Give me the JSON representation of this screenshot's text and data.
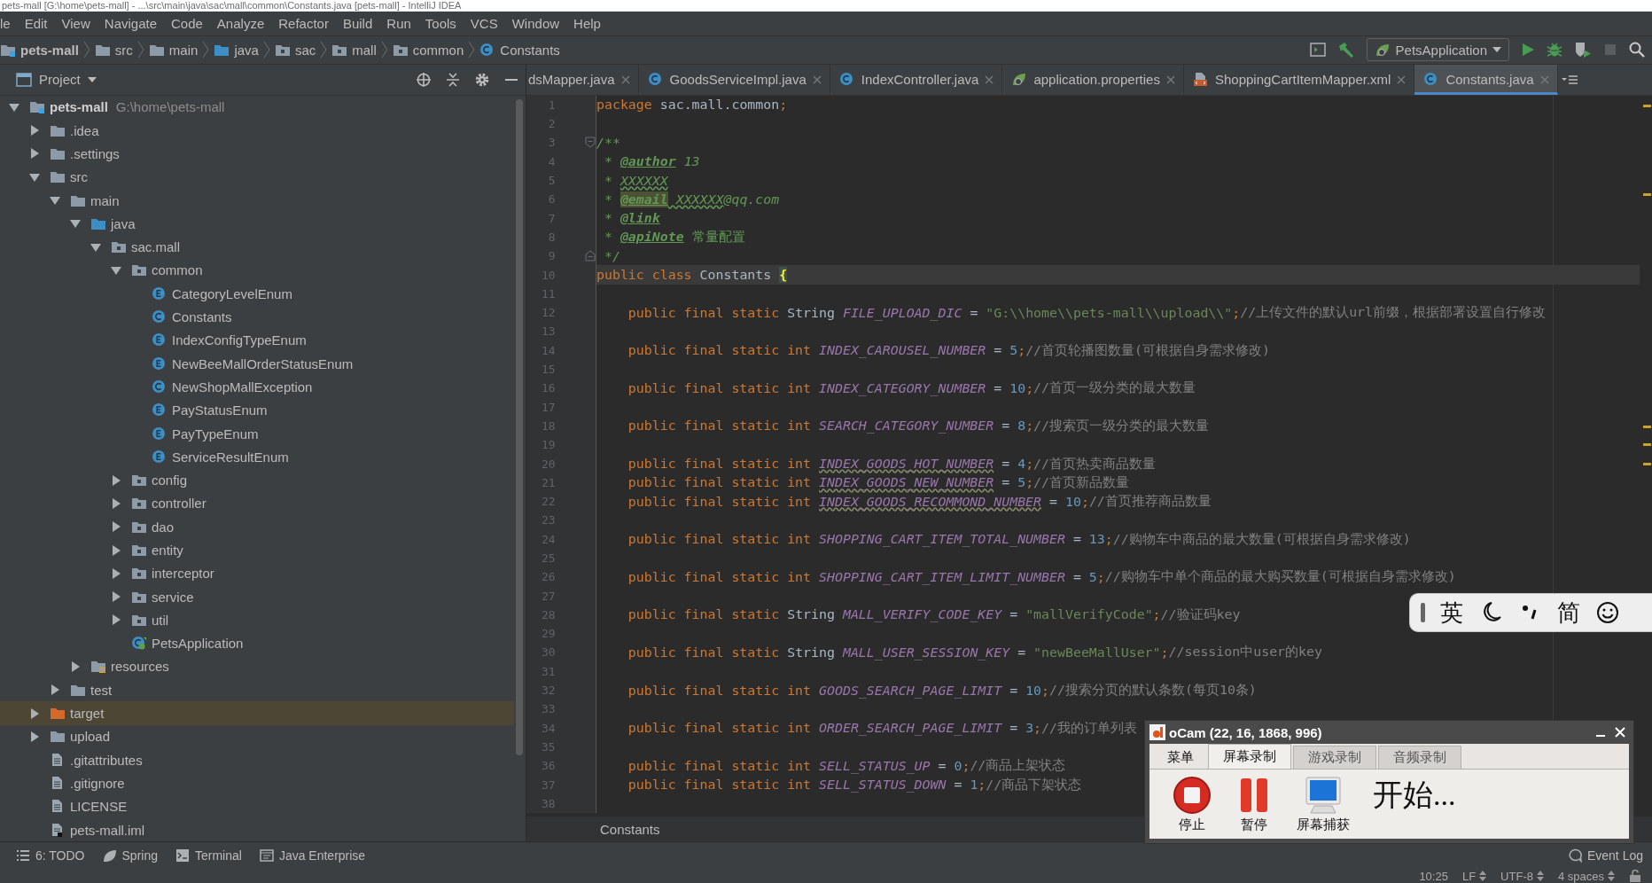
{
  "window": {
    "title": "pets-mall [G:\\home\\pets-mall] - ...\\src\\main\\java\\sac\\mall\\common\\Constants.java [pets-mall] - IntelliJ IDEA"
  },
  "menu": [
    "le",
    "Edit",
    "View",
    "Navigate",
    "Code",
    "Analyze",
    "Refactor",
    "Build",
    "Run",
    "Tools",
    "VCS",
    "Window",
    "Help"
  ],
  "breadcrumbs": [
    {
      "label": "pets-mall",
      "kind": "module"
    },
    {
      "label": "src",
      "kind": "folder"
    },
    {
      "label": "main",
      "kind": "folder"
    },
    {
      "label": "java",
      "kind": "source_folder"
    },
    {
      "label": "sac",
      "kind": "package"
    },
    {
      "label": "mall",
      "kind": "package"
    },
    {
      "label": "common",
      "kind": "package"
    },
    {
      "label": "Constants",
      "kind": "class"
    }
  ],
  "run_configuration": "PetsApplication",
  "project_panel": {
    "title": "Project"
  },
  "project_tree": [
    {
      "label": "pets-mall",
      "path": "G:\\home\\pets-mall",
      "kind": "module",
      "expanded": true,
      "selected": false,
      "children": [
        {
          "label": ".idea",
          "kind": "folder",
          "expanded": false,
          "selected": false
        },
        {
          "label": ".settings",
          "kind": "folder",
          "expanded": false,
          "selected": false
        },
        {
          "label": "src",
          "kind": "folder",
          "expanded": true,
          "selected": false,
          "children": [
            {
              "label": "main",
              "kind": "folder",
              "expanded": true,
              "selected": false,
              "children": [
                {
                  "label": "java",
                  "kind": "source_folder",
                  "expanded": true,
                  "selected": false,
                  "children": [
                    {
                      "label": "sac.mall",
                      "kind": "package",
                      "expanded": true,
                      "selected": false,
                      "children": [
                        {
                          "label": "common",
                          "kind": "package",
                          "expanded": true,
                          "selected": false,
                          "children": [
                            {
                              "label": "CategoryLevelEnum",
                              "kind": "enum",
                              "selected": false
                            },
                            {
                              "label": "Constants",
                              "kind": "class",
                              "selected": false
                            },
                            {
                              "label": "IndexConfigTypeEnum",
                              "kind": "enum",
                              "selected": false
                            },
                            {
                              "label": "NewBeeMallOrderStatusEnum",
                              "kind": "enum",
                              "selected": false
                            },
                            {
                              "label": "NewShopMallException",
                              "kind": "class",
                              "selected": false
                            },
                            {
                              "label": "PayStatusEnum",
                              "kind": "enum",
                              "selected": false
                            },
                            {
                              "label": "PayTypeEnum",
                              "kind": "enum",
                              "selected": false
                            },
                            {
                              "label": "ServiceResultEnum",
                              "kind": "enum",
                              "selected": false
                            }
                          ]
                        },
                        {
                          "label": "config",
                          "kind": "package",
                          "expanded": false,
                          "selected": false
                        },
                        {
                          "label": "controller",
                          "kind": "package",
                          "expanded": false,
                          "selected": false
                        },
                        {
                          "label": "dao",
                          "kind": "package",
                          "expanded": false,
                          "selected": false
                        },
                        {
                          "label": "entity",
                          "kind": "package",
                          "expanded": false,
                          "selected": false
                        },
                        {
                          "label": "interceptor",
                          "kind": "package",
                          "expanded": false,
                          "selected": false
                        },
                        {
                          "label": "service",
                          "kind": "package",
                          "expanded": false,
                          "selected": false
                        },
                        {
                          "label": "util",
                          "kind": "package",
                          "expanded": false,
                          "selected": false
                        },
                        {
                          "label": "PetsApplication",
                          "kind": "app",
                          "selected": false
                        }
                      ]
                    }
                  ]
                },
                {
                  "label": "resources",
                  "kind": "resources",
                  "expanded": false,
                  "selected": false
                }
              ]
            },
            {
              "label": "test",
              "kind": "folder",
              "expanded": false,
              "selected": false
            }
          ]
        },
        {
          "label": "target",
          "kind": "excluded",
          "expanded": false,
          "selected": true
        },
        {
          "label": "upload",
          "kind": "folder",
          "expanded": false,
          "selected": false
        },
        {
          "label": ".gitattributes",
          "kind": "file",
          "selected": false
        },
        {
          "label": ".gitignore",
          "kind": "file",
          "selected": false
        },
        {
          "label": "LICENSE",
          "kind": "file",
          "selected": false
        },
        {
          "label": "pets-mall.iml",
          "kind": "iml",
          "selected": false
        }
      ]
    }
  ],
  "editor_tabs": [
    {
      "label": "dsMapper.java",
      "selected": false
    },
    {
      "label": "GoodsServiceImpl.java",
      "kind": "class",
      "selected": false
    },
    {
      "label": "IndexController.java",
      "kind": "class",
      "selected": false
    },
    {
      "label": "application.properties",
      "kind": "spring",
      "selected": false
    },
    {
      "label": "ShoppingCartItemMapper.xml",
      "kind": "xml",
      "selected": false
    },
    {
      "label": "Constants.java",
      "kind": "class",
      "selected": true
    }
  ],
  "code_lines": [
    {
      "number": "1",
      "kind": "code",
      "current": false,
      "tokens": [
        {
          "kind": "kw",
          "text": "package"
        },
        {
          "kind": "plain",
          "text": " sac.mall.common"
        },
        {
          "kind": "kw",
          "text": ";"
        }
      ]
    },
    {
      "number": "2",
      "kind": "code",
      "current": false
    },
    {
      "number": "3",
      "kind": "fold_start",
      "current": false,
      "tokens": [
        {
          "kind": "doc",
          "text": "/**"
        }
      ]
    },
    {
      "number": "4",
      "kind": "code",
      "current": false,
      "tokens": [
        {
          "kind": "doc",
          "text": " * "
        },
        {
          "kind": "doc_tag",
          "text": "@author"
        },
        {
          "kind": "doc",
          "text": " 13"
        }
      ]
    },
    {
      "number": "5",
      "kind": "code",
      "current": false,
      "tokens": [
        {
          "kind": "doc",
          "text": " * "
        },
        {
          "kind": "doc_ref",
          "text": "XXXXXX"
        }
      ]
    },
    {
      "number": "6",
      "kind": "code",
      "current": false,
      "tokens": [
        {
          "kind": "doc",
          "text": " * "
        },
        {
          "kind": "doc_tag_hl",
          "text": "@email"
        },
        {
          "kind": "doc_ref",
          "text": " XXXXXX"
        },
        {
          "kind": "doc",
          "text": "@qq.com"
        }
      ]
    },
    {
      "number": "7",
      "kind": "code",
      "current": false,
      "tokens": [
        {
          "kind": "doc",
          "text": " * "
        },
        {
          "kind": "doc_tag",
          "text": "@link"
        }
      ]
    },
    {
      "number": "8",
      "kind": "code",
      "current": false,
      "tokens": [
        {
          "kind": "doc",
          "text": " * "
        },
        {
          "kind": "doc_tag",
          "text": "@apiNote"
        },
        {
          "kind": "doc_plain",
          "text": " 常量配置"
        }
      ]
    },
    {
      "number": "9",
      "kind": "fold_end",
      "current": false,
      "tokens": [
        {
          "kind": "doc",
          "text": " */"
        }
      ]
    },
    {
      "number": "10",
      "kind": "code",
      "current": true,
      "tokens": [
        {
          "kind": "kw",
          "text": "public class"
        },
        {
          "kind": "plain",
          "text": " Constants "
        },
        {
          "kind": "brace",
          "text": "{"
        }
      ]
    },
    {
      "number": "11",
      "kind": "code",
      "current": false
    },
    {
      "number": "12",
      "kind": "code",
      "current": false,
      "tokens": [
        {
          "kind": "kw",
          "text": "    public final static"
        },
        {
          "kind": "plain",
          "text": " String "
        },
        {
          "kind": "const",
          "text": "FILE_UPLOAD_DIC"
        },
        {
          "kind": "plain",
          "text": " = "
        },
        {
          "kind": "str",
          "text": "\"G:\\\\home\\\\pets-mall\\\\upload\\\\\""
        },
        {
          "kind": "kw",
          "text": ";"
        },
        {
          "kind": "cmt",
          "text": "//上传文件的默认url前缀，根据部署设置自行修改"
        }
      ]
    },
    {
      "number": "13",
      "kind": "code",
      "current": false
    },
    {
      "number": "14",
      "kind": "code",
      "current": false,
      "tokens": [
        {
          "kind": "kw",
          "text": "    public final static int "
        },
        {
          "kind": "const",
          "text": "INDEX_CAROUSEL_NUMBER"
        },
        {
          "kind": "plain",
          "text": " = "
        },
        {
          "kind": "num",
          "text": "5"
        },
        {
          "kind": "kw",
          "text": ";"
        },
        {
          "kind": "cmt",
          "text": "//首页轮播图数量(可根据自身需求修改)"
        }
      ]
    },
    {
      "number": "15",
      "kind": "code",
      "current": false
    },
    {
      "number": "16",
      "kind": "code",
      "current": false,
      "tokens": [
        {
          "kind": "kw",
          "text": "    public final static int "
        },
        {
          "kind": "const",
          "text": "INDEX_CATEGORY_NUMBER"
        },
        {
          "kind": "plain",
          "text": " = "
        },
        {
          "kind": "num",
          "text": "10"
        },
        {
          "kind": "kw",
          "text": ";"
        },
        {
          "kind": "cmt",
          "text": "//首页一级分类的最大数量"
        }
      ]
    },
    {
      "number": "17",
      "kind": "code",
      "current": false
    },
    {
      "number": "18",
      "kind": "code",
      "current": false,
      "tokens": [
        {
          "kind": "kw",
          "text": "    public final static int "
        },
        {
          "kind": "const",
          "text": "SEARCH_CATEGORY_NUMBER"
        },
        {
          "kind": "plain",
          "text": " = "
        },
        {
          "kind": "num",
          "text": "8"
        },
        {
          "kind": "kw",
          "text": ";"
        },
        {
          "kind": "cmt",
          "text": "//搜索页一级分类的最大数量"
        }
      ]
    },
    {
      "number": "19",
      "kind": "code",
      "current": false
    },
    {
      "number": "20",
      "kind": "code",
      "current": false,
      "tokens": [
        {
          "kind": "kw",
          "text": "    public final static int "
        },
        {
          "kind": "const_warn",
          "text": "INDEX_GOODS_HOT_NUMBER"
        },
        {
          "kind": "plain",
          "text": " = "
        },
        {
          "kind": "num",
          "text": "4"
        },
        {
          "kind": "kw",
          "text": ";"
        },
        {
          "kind": "cmt",
          "text": "//首页热卖商品数量"
        }
      ]
    },
    {
      "number": "21",
      "kind": "code",
      "current": false,
      "tokens": [
        {
          "kind": "kw",
          "text": "    public final static int "
        },
        {
          "kind": "const_warn",
          "text": "INDEX_GOODS_NEW_NUMBER"
        },
        {
          "kind": "plain",
          "text": " = "
        },
        {
          "kind": "num",
          "text": "5"
        },
        {
          "kind": "kw",
          "text": ";"
        },
        {
          "kind": "cmt",
          "text": "//首页新品数量"
        }
      ]
    },
    {
      "number": "22",
      "kind": "code",
      "current": false,
      "tokens": [
        {
          "kind": "kw",
          "text": "    public final static int "
        },
        {
          "kind": "const_warn",
          "text": "INDEX_GOODS_RECOMMOND_NUMBER"
        },
        {
          "kind": "plain",
          "text": " = "
        },
        {
          "kind": "num",
          "text": "10"
        },
        {
          "kind": "kw",
          "text": ";"
        },
        {
          "kind": "cmt",
          "text": "//首页推荐商品数量"
        }
      ]
    },
    {
      "number": "23",
      "kind": "code",
      "current": false
    },
    {
      "number": "24",
      "kind": "code",
      "current": false,
      "tokens": [
        {
          "kind": "kw",
          "text": "    public final static int "
        },
        {
          "kind": "const",
          "text": "SHOPPING_CART_ITEM_TOTAL_NUMBER"
        },
        {
          "kind": "plain",
          "text": " = "
        },
        {
          "kind": "num",
          "text": "13"
        },
        {
          "kind": "kw",
          "text": ";"
        },
        {
          "kind": "cmt",
          "text": "//购物车中商品的最大数量(可根据自身需求修改)"
        }
      ]
    },
    {
      "number": "25",
      "kind": "code",
      "current": false
    },
    {
      "number": "26",
      "kind": "code",
      "current": false,
      "tokens": [
        {
          "kind": "kw",
          "text": "    public final static int "
        },
        {
          "kind": "const",
          "text": "SHOPPING_CART_ITEM_LIMIT_NUMBER"
        },
        {
          "kind": "plain",
          "text": " = "
        },
        {
          "kind": "num",
          "text": "5"
        },
        {
          "kind": "kw",
          "text": ";"
        },
        {
          "kind": "cmt",
          "text": "//购物车中单个商品的最大购买数量(可根据自身需求修改)"
        }
      ]
    },
    {
      "number": "27",
      "kind": "code",
      "current": false
    },
    {
      "number": "28",
      "kind": "code",
      "current": false,
      "tokens": [
        {
          "kind": "kw",
          "text": "    public final static"
        },
        {
          "kind": "plain",
          "text": " String "
        },
        {
          "kind": "const",
          "text": "MALL_VERIFY_CODE_KEY"
        },
        {
          "kind": "plain",
          "text": " = "
        },
        {
          "kind": "str",
          "text": "\"mallVerifyCode\""
        },
        {
          "kind": "kw",
          "text": ";"
        },
        {
          "kind": "cmt",
          "text": "//验证码key"
        }
      ]
    },
    {
      "number": "29",
      "kind": "code",
      "current": false
    },
    {
      "number": "30",
      "kind": "code",
      "current": false,
      "tokens": [
        {
          "kind": "kw",
          "text": "    public final static"
        },
        {
          "kind": "plain",
          "text": " String "
        },
        {
          "kind": "const",
          "text": "MALL_USER_SESSION_KEY"
        },
        {
          "kind": "plain",
          "text": " = "
        },
        {
          "kind": "str",
          "text": "\"newBeeMallUser\""
        },
        {
          "kind": "kw",
          "text": ";"
        },
        {
          "kind": "cmt",
          "text": "//session中user的key"
        }
      ]
    },
    {
      "number": "31",
      "kind": "code",
      "current": false
    },
    {
      "number": "32",
      "kind": "code",
      "current": false,
      "tokens": [
        {
          "kind": "kw",
          "text": "    public final static int "
        },
        {
          "kind": "const",
          "text": "GOODS_SEARCH_PAGE_LIMIT"
        },
        {
          "kind": "plain",
          "text": " = "
        },
        {
          "kind": "num",
          "text": "10"
        },
        {
          "kind": "kw",
          "text": ";"
        },
        {
          "kind": "cmt",
          "text": "//搜索分页的默认条数(每页10条)"
        }
      ]
    },
    {
      "number": "33",
      "kind": "code",
      "current": false
    },
    {
      "number": "34",
      "kind": "code",
      "current": false,
      "tokens": [
        {
          "kind": "kw",
          "text": "    public final static int "
        },
        {
          "kind": "const",
          "text": "ORDER_SEARCH_PAGE_LIMIT"
        },
        {
          "kind": "plain",
          "text": " = "
        },
        {
          "kind": "num",
          "text": "3"
        },
        {
          "kind": "kw",
          "text": ";"
        },
        {
          "kind": "cmt",
          "text": "//我的订单列表"
        }
      ]
    },
    {
      "number": "35",
      "kind": "code",
      "current": false
    },
    {
      "number": "36",
      "kind": "code",
      "current": false,
      "tokens": [
        {
          "kind": "kw",
          "text": "    public final static int "
        },
        {
          "kind": "const",
          "text": "SELL_STATUS_UP"
        },
        {
          "kind": "plain",
          "text": " = "
        },
        {
          "kind": "num",
          "text": "0"
        },
        {
          "kind": "kw",
          "text": ";"
        },
        {
          "kind": "cmt",
          "text": "//商品上架状态"
        }
      ]
    },
    {
      "number": "37",
      "kind": "code",
      "current": false,
      "tokens": [
        {
          "kind": "kw",
          "text": "    public final static int "
        },
        {
          "kind": "const",
          "text": "SELL_STATUS_DOWN"
        },
        {
          "kind": "plain",
          "text": " = "
        },
        {
          "kind": "num",
          "text": "1"
        },
        {
          "kind": "kw",
          "text": ";"
        },
        {
          "kind": "cmt",
          "text": "//商品下架状态"
        }
      ]
    },
    {
      "number": "38",
      "kind": "code",
      "current": false
    }
  ],
  "editor_breadcrumb": "Constants",
  "tool_windows": [
    {
      "label": "6: TODO",
      "kind": "todo"
    },
    {
      "label": "Spring",
      "kind": "spring"
    },
    {
      "label": "Terminal",
      "kind": "terminal"
    },
    {
      "label": "Java Enterprise",
      "kind": "enterprise"
    }
  ],
  "event_log": "Event Log",
  "status_bar": [
    {
      "label": "10:25",
      "kind": "position"
    },
    {
      "label": "LF",
      "kind": "choice"
    },
    {
      "label": "UTF-8",
      "kind": "choice"
    },
    {
      "label": "4 spaces",
      "kind": "choice"
    }
  ],
  "ocam": {
    "title": "oCam (22, 16, 1868, 996)",
    "menu_button": "菜单",
    "tabs": [
      {
        "label": "屏幕录制",
        "selected": true
      },
      {
        "label": "游戏录制",
        "selected": false
      },
      {
        "label": "音频录制",
        "selected": false
      }
    ],
    "buttons": [
      {
        "label": "停止",
        "kind": "stop"
      },
      {
        "label": "暂停",
        "kind": "pause"
      },
      {
        "label": "屏幕捕获",
        "kind": "capture"
      }
    ],
    "status": "开始..."
  },
  "ime_toolbar": {
    "items": [
      {
        "kind": "text",
        "label": "英"
      },
      {
        "kind": "moon"
      },
      {
        "kind": "punctuation"
      },
      {
        "kind": "text",
        "label": "简"
      },
      {
        "kind": "emoji"
      }
    ]
  }
}
